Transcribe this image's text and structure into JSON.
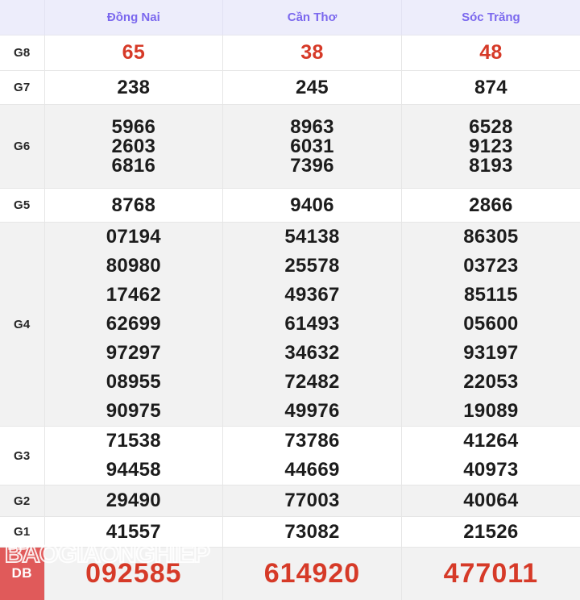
{
  "table": {
    "corner_label": "",
    "columns": [
      "Đồng Nai",
      "Cần Thơ",
      "Sóc Trăng"
    ],
    "rows": [
      {
        "label": "G8",
        "highlight": "red",
        "values": [
          [
            "65"
          ],
          [
            "38"
          ],
          [
            "48"
          ]
        ]
      },
      {
        "label": "G7",
        "highlight": "none",
        "values": [
          [
            "238"
          ],
          [
            "245"
          ],
          [
            "874"
          ]
        ]
      },
      {
        "label": "G6",
        "highlight": "none",
        "values": [
          [
            "5966",
            "2603",
            "6816"
          ],
          [
            "8963",
            "6031",
            "7396"
          ],
          [
            "6528",
            "9123",
            "8193"
          ]
        ]
      },
      {
        "label": "G5",
        "highlight": "none",
        "values": [
          [
            "8768"
          ],
          [
            "9406"
          ],
          [
            "2866"
          ]
        ]
      },
      {
        "label": "G4",
        "highlight": "none",
        "values": [
          [
            "07194",
            "80980",
            "17462",
            "62699",
            "97297",
            "08955",
            "90975"
          ],
          [
            "54138",
            "25578",
            "49367",
            "61493",
            "34632",
            "72482",
            "49976"
          ],
          [
            "86305",
            "03723",
            "85115",
            "05600",
            "93197",
            "22053",
            "19089"
          ]
        ]
      },
      {
        "label": "G3",
        "highlight": "none",
        "values": [
          [
            "71538",
            "94458"
          ],
          [
            "73786",
            "44669"
          ],
          [
            "41264",
            "40973"
          ]
        ]
      },
      {
        "label": "G2",
        "highlight": "none",
        "values": [
          [
            "29490"
          ],
          [
            "77003"
          ],
          [
            "40064"
          ]
        ]
      },
      {
        "label": "G1",
        "highlight": "none",
        "values": [
          [
            "41557"
          ],
          [
            "73082"
          ],
          [
            "21526"
          ]
        ]
      },
      {
        "label": "DB",
        "highlight": "special",
        "values": [
          [
            "092585"
          ],
          [
            "614920"
          ],
          [
            "477011"
          ]
        ]
      }
    ]
  },
  "watermark": {
    "line1": "DB",
    "line2": "BAOGIAONGHIEP"
  },
  "colors": {
    "header_bg": "#ededfb",
    "header_text": "#7b68ee",
    "row_shade": "#f2f2f2",
    "row_plain": "#ffffff",
    "number_text": "#1c1c1c",
    "prize_red": "#d63a28",
    "db_label_bg": "#e05a5a",
    "border": "#e6e6e6"
  }
}
